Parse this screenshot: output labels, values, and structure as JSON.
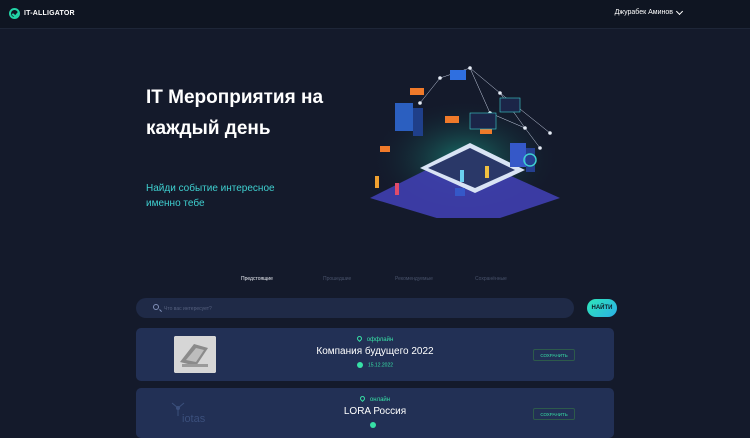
{
  "header": {
    "logo_text": "IT-ALLIGATOR",
    "user_name": "Джурабек Аминов"
  },
  "hero": {
    "title": "IT Мероприятия на каждый день",
    "subtitle": "Найди событие интересное именно тебе"
  },
  "tabs": [
    {
      "label": "Предстоящие",
      "active": true
    },
    {
      "label": "Прошедшие",
      "active": false
    },
    {
      "label": "Рекомендуемые",
      "active": false
    },
    {
      "label": "Сохранённые",
      "active": false
    }
  ],
  "search": {
    "placeholder": "Что вас интересует?",
    "button_label": "НАЙТИ"
  },
  "events": [
    {
      "format": "оффлайн",
      "title": "Компания будущего 2022",
      "date": "15.12.2022",
      "save_label": "СОХРАНИТЬ"
    },
    {
      "format": "онлайн",
      "title": "LORA Россия",
      "logo_text": "iotas",
      "save_label": "СОХРАНИТЬ"
    }
  ],
  "colors": {
    "background": "#141a2b",
    "accent": "#37e0a6",
    "card": "#223055"
  }
}
